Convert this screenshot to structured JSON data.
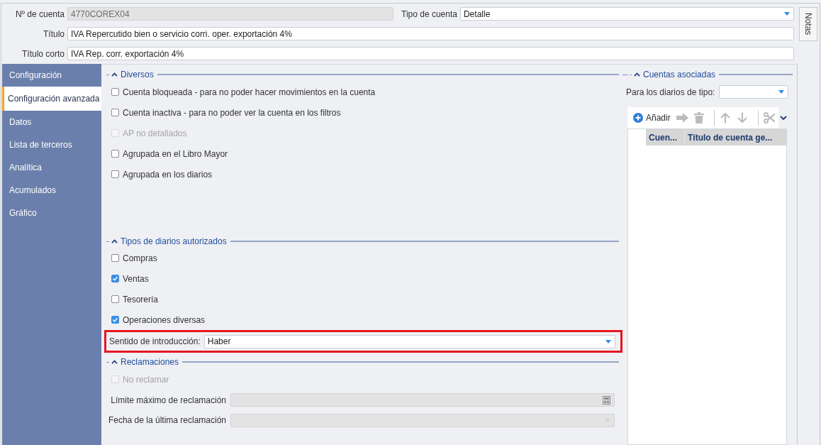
{
  "header": {
    "account_number": {
      "label": "Nº de cuenta",
      "value": "4770COREX04",
      "disabled": true
    },
    "account_type": {
      "label": "Tipo de cuenta",
      "value": "Detalle",
      "disabled": false
    },
    "title": {
      "label": "Título",
      "value": "IVA Repercutido bien o servicio corri. oper. exportación 4%",
      "disabled": false
    },
    "short_title": {
      "label": "Título corto",
      "value": "IVA Rep. corr. exportación 4%",
      "disabled": false
    }
  },
  "notes_tab": {
    "label": "Notas"
  },
  "sidebar": {
    "items": [
      {
        "label": "Configuración",
        "selected": false
      },
      {
        "label": "Configuración avanzada",
        "selected": true
      },
      {
        "label": "Datos",
        "selected": false
      },
      {
        "label": "Lista de terceros",
        "selected": false
      },
      {
        "label": "Analítica",
        "selected": false
      },
      {
        "label": "Acumulados",
        "selected": false
      },
      {
        "label": "Gráfico",
        "selected": false
      }
    ]
  },
  "miscellaneous": {
    "title": "Diversos",
    "expanded": true,
    "options": [
      {
        "label": "Cuenta bloqueada - para no poder hacer movimientos en la cuenta",
        "checked": false,
        "disabled": false
      },
      {
        "label": "Cuenta inactiva - para no poder ver la cuenta en los filtros",
        "checked": false,
        "disabled": false
      },
      {
        "label": "AP no detallados",
        "checked": false,
        "disabled": true
      },
      {
        "label": "Agrupada en el Libro Mayor",
        "checked": false,
        "disabled": false
      },
      {
        "label": "Agrupada en los diarios",
        "checked": false,
        "disabled": false
      }
    ]
  },
  "journal_types": {
    "title": "Tipos de diarios autorizados",
    "expanded": true,
    "options": [
      {
        "label": "Compras",
        "checked": false,
        "disabled": false
      },
      {
        "label": "Ventas",
        "checked": true,
        "disabled": false
      },
      {
        "label": "Tesorería",
        "checked": false,
        "disabled": false
      },
      {
        "label": "Operaciones diversas",
        "checked": true,
        "disabled": false
      }
    ],
    "entry_direction": {
      "label": "Sentido de introducción:",
      "value": "Haber",
      "highlighted": true
    }
  },
  "claims": {
    "title": "Reclamaciones",
    "expanded": true,
    "no_claim": {
      "label": "No reclamar",
      "checked": false,
      "disabled": true
    },
    "fields": [
      {
        "kind": "amount",
        "label": "Límite máximo de reclamación",
        "disabled": true
      },
      {
        "kind": "date",
        "label": "Fecha de la última reclamación",
        "disabled": true
      }
    ]
  },
  "linked_accounts": {
    "title": "Cuentas asociadas",
    "expanded": true,
    "journal_type": {
      "label": "Para los diarios de tipo:"
    },
    "toolbar": {
      "groups": [
        [
          {
            "kind": "add",
            "label": "Añadir",
            "disabled": false
          },
          {
            "kind": "forward",
            "disabled": true
          },
          {
            "kind": "delete",
            "disabled": true
          }
        ],
        [
          {
            "kind": "up",
            "disabled": true
          },
          {
            "kind": "down",
            "disabled": true
          }
        ],
        [
          {
            "kind": "cut",
            "disabled": true
          }
        ]
      ]
    },
    "table": {
      "columns": [
        "Cuen...",
        "Título de cuenta ge..."
      ]
    }
  }
}
